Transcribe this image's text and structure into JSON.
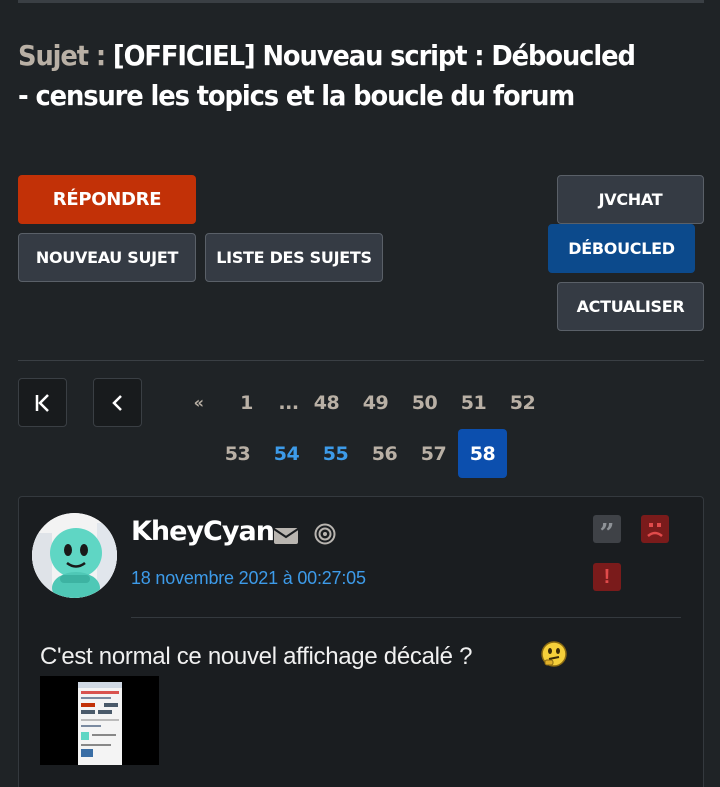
{
  "topic": {
    "prefix": "Sujet : ",
    "title": "[OFFICIEL] Nouveau script : Déboucled - censure les topics et la boucle du forum"
  },
  "buttons": {
    "reply": "RÉPONDRE",
    "new_topic": "NOUVEAU SUJET",
    "topic_list": "LISTE DES SUJETS",
    "jvchat": "JVCHAT",
    "deboucled": "DÉBOUCLED",
    "refresh": "ACTUALISER"
  },
  "pagination": {
    "first_icon": "first-page-icon",
    "prev_icon": "previous-page-icon",
    "prev_double": "«",
    "row1": [
      "1",
      "...",
      "48",
      "49",
      "50",
      "51",
      "52"
    ],
    "row2": [
      "53",
      "54",
      "55",
      "56",
      "57"
    ],
    "current": "58"
  },
  "post": {
    "author": "KheyCyan",
    "date": "18 novembre 2021 à 00:27:05",
    "text": "C'est normal ce nouvel affichage décalé ?",
    "icons": [
      "mail-icon",
      "spiral-icon",
      "quote-icon",
      "sad-face-icon",
      "alert-icon",
      "thinking-smiley-icon"
    ]
  },
  "colors": {
    "background": "#1f2326",
    "reply_button": "#c23107",
    "deboucled_button": "#0c4a8c",
    "link_blue": "#3d9be9",
    "current_page": "#0c4fae",
    "title_prefix": "#b9b0a5"
  }
}
